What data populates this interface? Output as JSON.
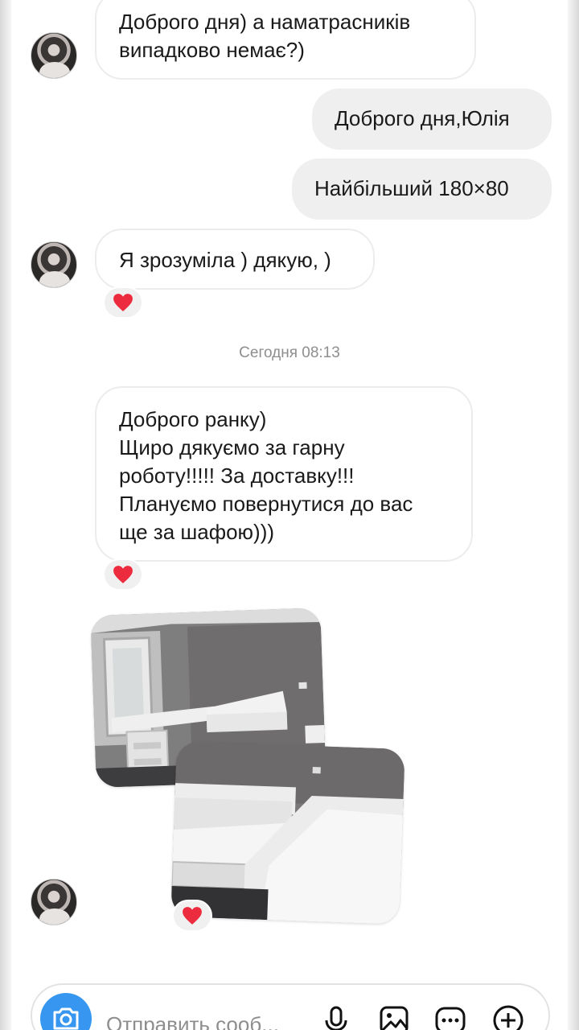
{
  "messages": [
    {
      "id": "m1",
      "direction": "incoming",
      "lines": [
        "Доброго дня) а наматрасників",
        "випадково немає?)"
      ]
    },
    {
      "id": "m2",
      "direction": "outgoing",
      "text": "Доброго дня,Юлія"
    },
    {
      "id": "m3",
      "direction": "outgoing",
      "text": "Найбільший 180×80"
    },
    {
      "id": "m4",
      "direction": "incoming",
      "text": "Я зрозуміла ) дякую, )",
      "reaction": "❤"
    },
    {
      "id": "m5",
      "direction": "incoming",
      "lines": [
        "Доброго ранку)",
        "Щиро дякуємо за гарну",
        "роботу!!!!! За доставку!!!",
        "Плануємо повернутися до вас",
        "ще за шафою)))"
      ],
      "reaction": "❤"
    },
    {
      "id": "m6",
      "direction": "incoming",
      "type": "photos",
      "count": 2,
      "reaction": "❤"
    }
  ],
  "timestamp": "Сегодня 08:13",
  "composer": {
    "placeholder": "Отправить сооб...",
    "icons": [
      "camera-icon",
      "microphone-icon",
      "gallery-icon",
      "sticker-icon",
      "plus-icon"
    ]
  },
  "colors": {
    "accent": "#3797f0",
    "heart": "#ed2b3e",
    "outgoing_bubble": "#efefef"
  }
}
